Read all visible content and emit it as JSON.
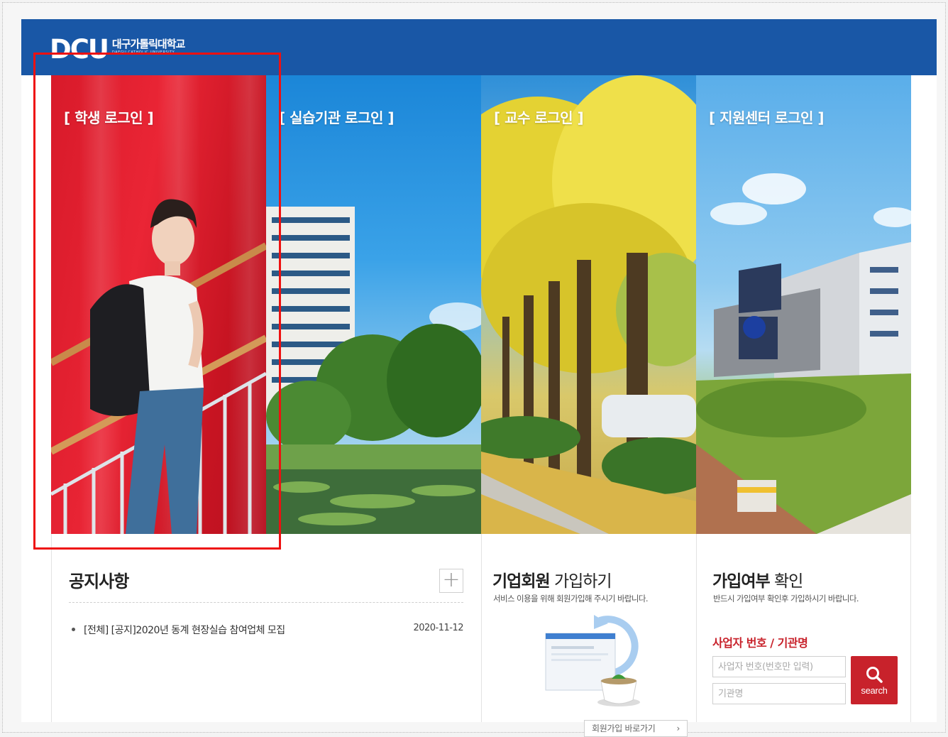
{
  "header": {
    "logo_mark": "DCU",
    "logo_korean": "대구가톨릭대학교",
    "logo_english": "DAEGU CATHOLIC UNIVERSITY"
  },
  "panels": [
    {
      "title": "[ 학생 로그인 ]"
    },
    {
      "title": "[ 실습기관 로그인 ]"
    },
    {
      "title": "[ 교수 로그인 ]"
    },
    {
      "title": "[ 지원센터 로그인 ]"
    }
  ],
  "notice": {
    "title": "공지사항",
    "more_symbol": "+",
    "items": [
      {
        "text": "[전체] [공지]2020년 동계 현장실습 참여업체 모집",
        "date": "2020-11-12"
      }
    ]
  },
  "join": {
    "title_bold": "기업회원",
    "title_rest": " 가입하기",
    "description": "서비스 이용을 위해 회원가입해 주시기 바랍니다.",
    "link_label": "회원가입 바로가기",
    "link_arrow": "›"
  },
  "check": {
    "title_bold": "가입여부",
    "title_rest": " 확인",
    "description": "반드시 가입여부 확인후 가입하시기 바랍니다.",
    "subtitle": "사업자 번호 / 기관명",
    "business_number_placeholder": "사업자 번호(번호만 입력)",
    "org_name_placeholder": "기관명",
    "search_label": "search"
  },
  "colors": {
    "topbar": "#1957a6",
    "student_red": "#e62333",
    "accent_red": "#c8222b",
    "highlight_outline": "#ee1111"
  }
}
